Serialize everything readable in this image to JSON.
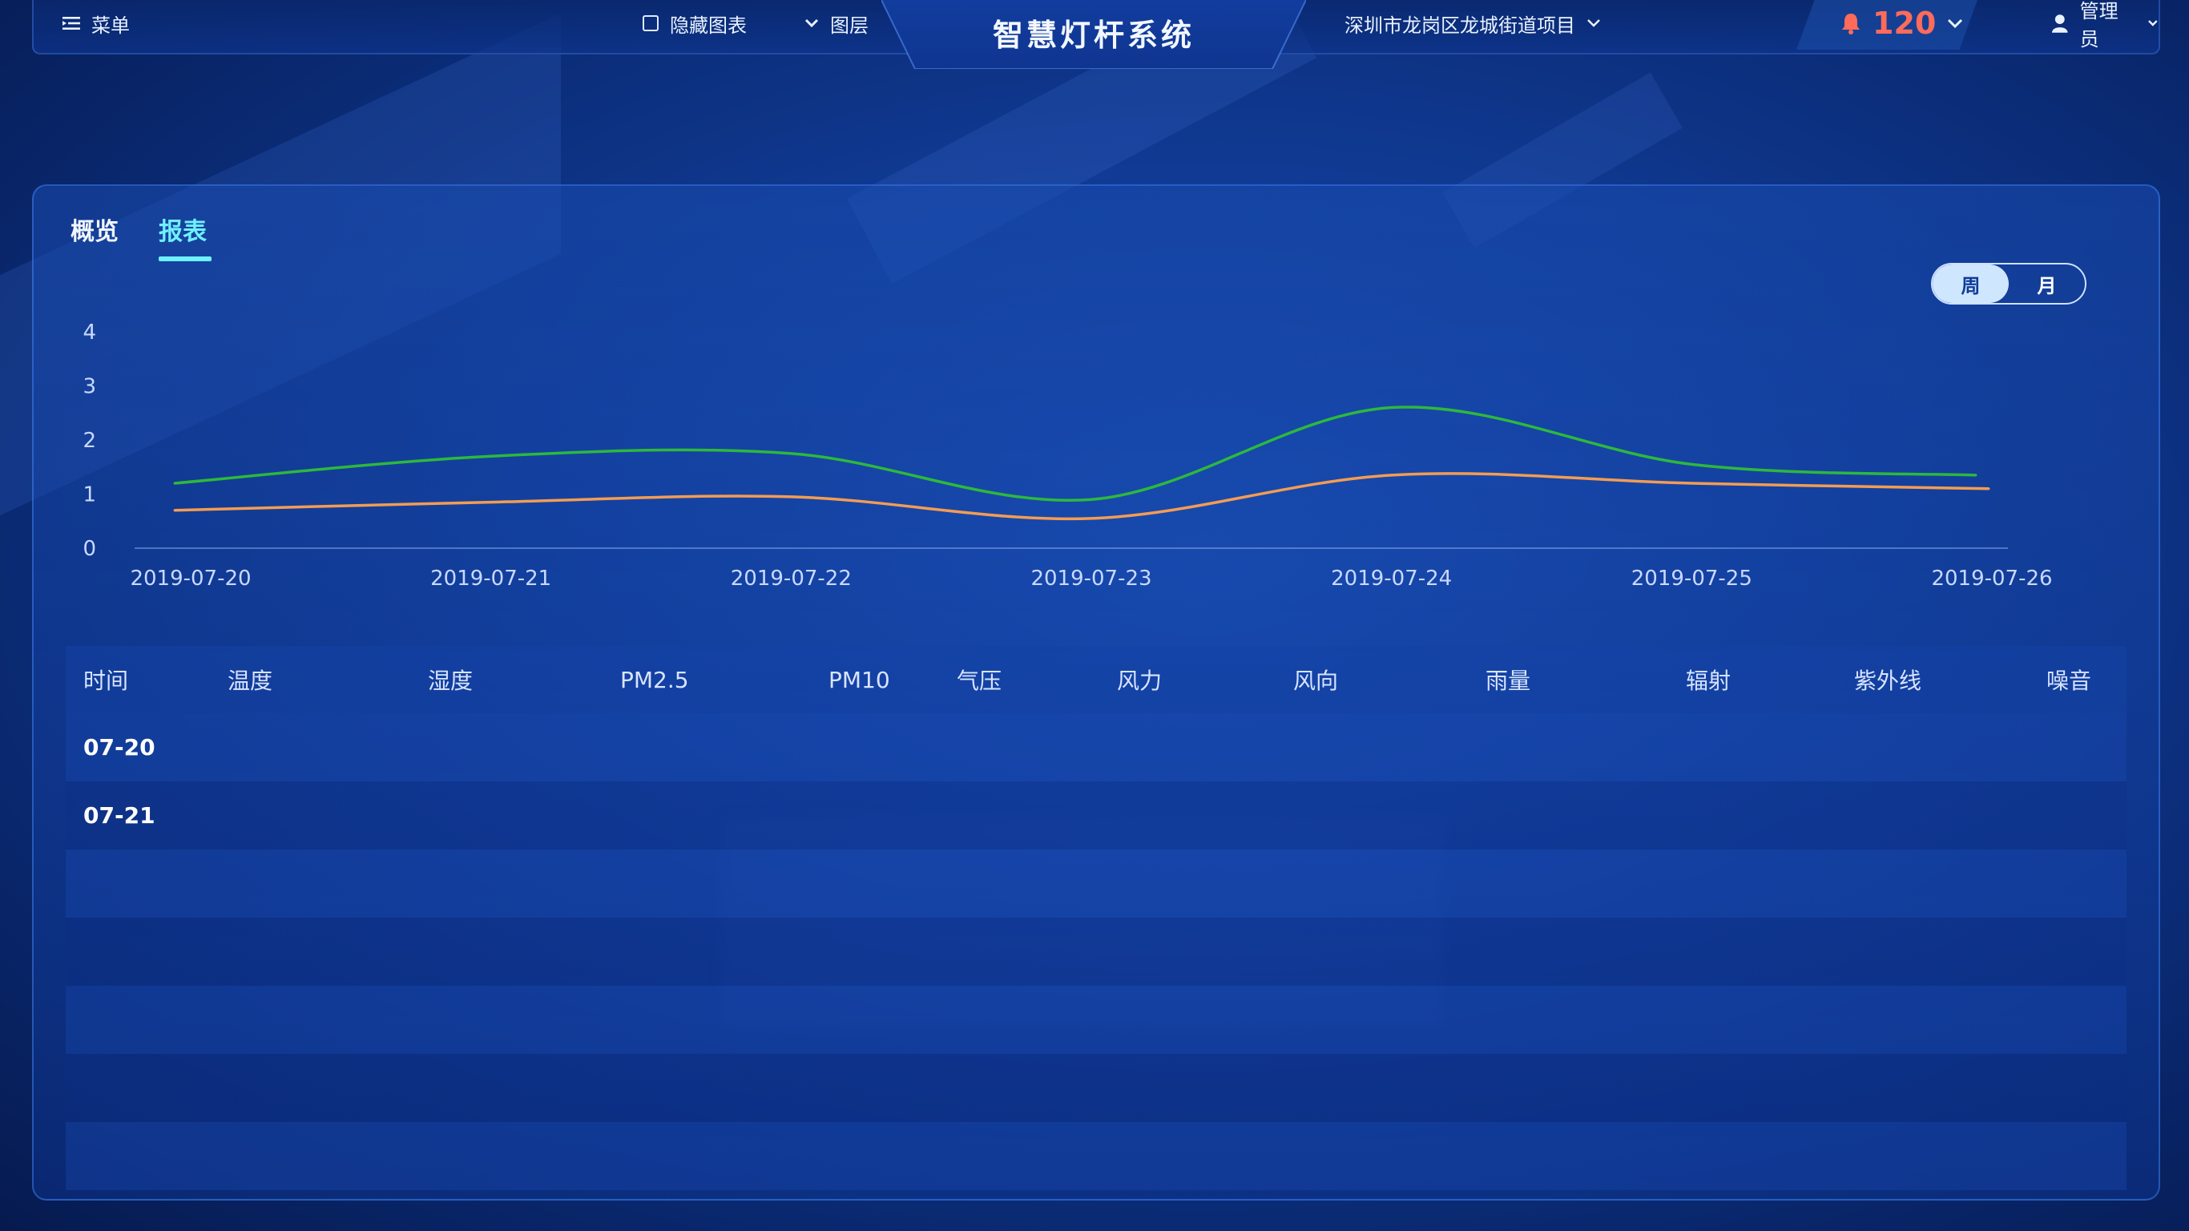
{
  "header": {
    "menu_label": "菜单",
    "hide_chart_label": "隐藏图表",
    "layers_label": "图层",
    "title": "智慧灯杆系统",
    "location": "深圳市龙岗区龙城街道项目",
    "alarm_count": "120",
    "user": "管理员"
  },
  "tabs": [
    {
      "label": "概览",
      "active": false
    },
    {
      "label": "报表",
      "active": true
    }
  ],
  "period_toggle": {
    "week": "周",
    "month": "月",
    "selected": "周"
  },
  "chart_data": {
    "type": "line",
    "x": [
      "2019-07-20",
      "2019-07-21",
      "2019-07-22",
      "2019-07-23",
      "2019-07-24",
      "2019-07-25",
      "2019-07-26"
    ],
    "ylim": [
      0,
      4
    ],
    "yticks": [
      "0",
      "1",
      "2",
      "3",
      "4"
    ],
    "grid": false,
    "series": [
      {
        "color": "#2db83d",
        "values": [
          1.2,
          1.7,
          1.75,
          0.9,
          2.6,
          1.55,
          1.35
        ]
      },
      {
        "color": "#f39c53",
        "values": [
          0.7,
          0.85,
          0.95,
          0.55,
          1.35,
          1.2,
          1.1
        ]
      }
    ]
  },
  "table": {
    "columns": [
      "时间",
      "温度",
      "湿度",
      "PM2.5",
      "PM10",
      "气压",
      "风力",
      "风向",
      "雨量",
      "辐射",
      "紫外线",
      "噪音"
    ],
    "rows": [
      [
        "07-20",
        "",
        "",
        "",
        "",
        "",
        "",
        "",
        "",
        "",
        "",
        ""
      ],
      [
        "07-21",
        "",
        "",
        "",
        "",
        "",
        "",
        "",
        "",
        "",
        "",
        ""
      ],
      [
        "",
        "",
        "",
        "",
        "",
        "",
        "",
        "",
        "",
        "",
        "",
        ""
      ],
      [
        "",
        "",
        "",
        "",
        "",
        "",
        "",
        "",
        "",
        "",
        "",
        ""
      ],
      [
        "",
        "",
        "",
        "",
        "",
        "",
        "",
        "",
        "",
        "",
        "",
        ""
      ],
      [
        "",
        "",
        "",
        "",
        "",
        "",
        "",
        "",
        "",
        "",
        "",
        ""
      ],
      [
        "",
        "",
        "",
        "",
        "",
        "",
        "",
        "",
        "",
        "",
        "",
        ""
      ]
    ]
  }
}
